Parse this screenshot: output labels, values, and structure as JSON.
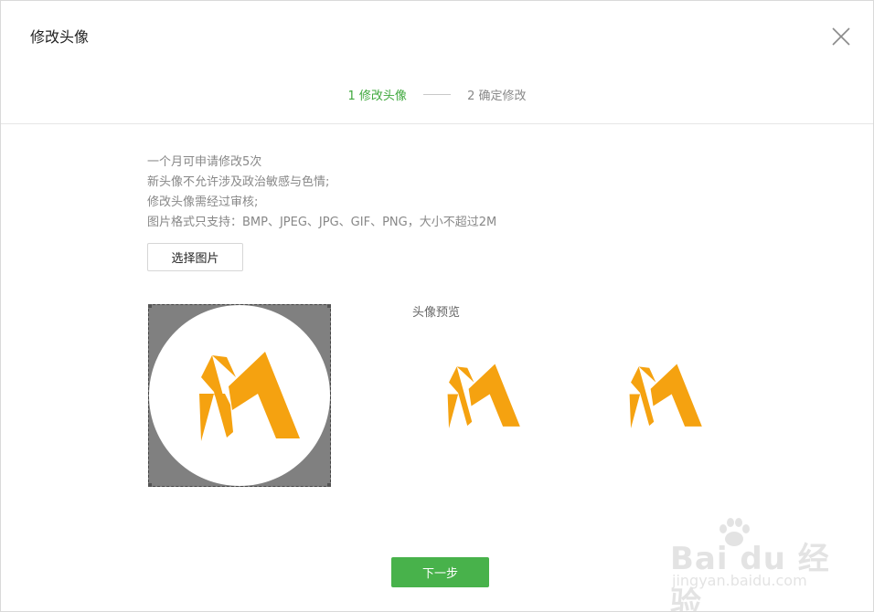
{
  "dialog": {
    "title": "修改头像"
  },
  "steps": [
    {
      "label": "1 修改头像",
      "active": true
    },
    {
      "label": "2 确定修改",
      "active": false
    }
  ],
  "info_lines": [
    "一个月可申请修改5次",
    "新头像不允许涉及政治敏感与色情;",
    "修改头像需经过审核;",
    "图片格式只支持：BMP、JPEG、JPG、GIF、PNG，大小不超过2M"
  ],
  "buttons": {
    "choose_image": "选择图片",
    "next": "下一步"
  },
  "preview": {
    "label": "头像预览"
  },
  "watermark": {
    "brand": "Bai du 经验",
    "url": "jingyan.baidu.com"
  },
  "colors": {
    "accent_green": "#3fa83d",
    "button_green": "#48b24b",
    "logo_orange": "#f5a210",
    "crop_mask": "#808080"
  },
  "icons": {
    "close": "close-icon",
    "logo": "m-logo-icon"
  }
}
